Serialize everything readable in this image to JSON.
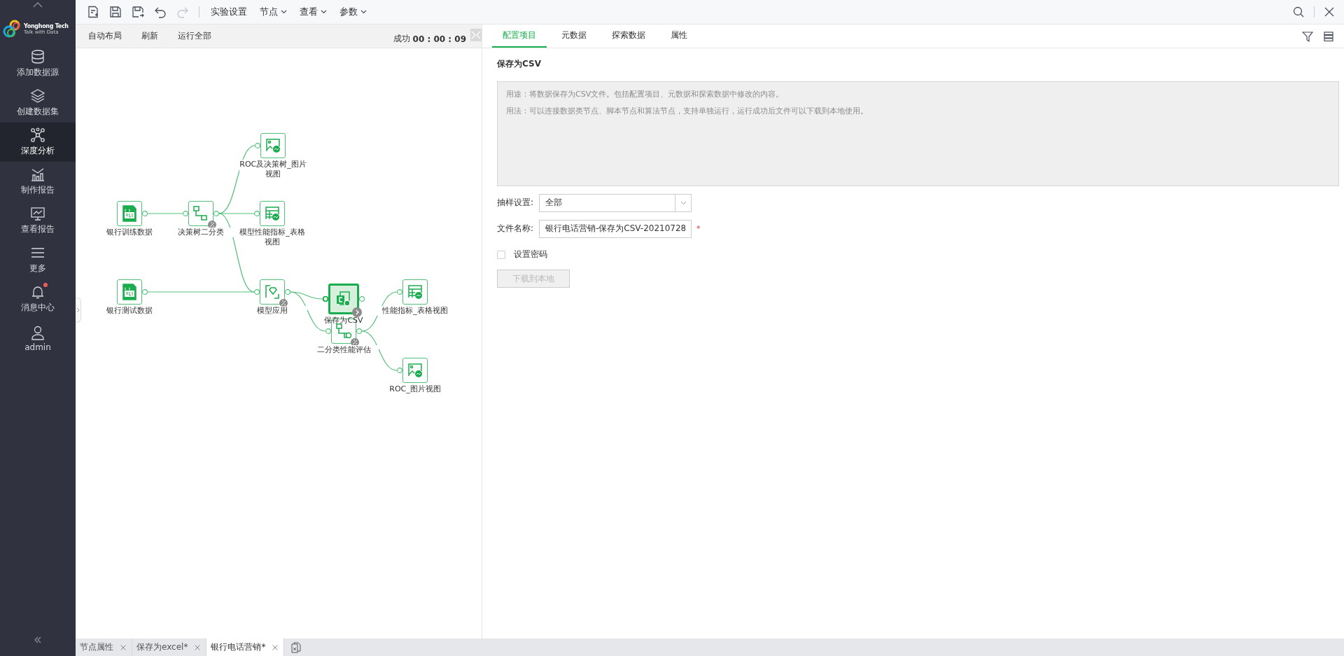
{
  "sidebar": {
    "logo": {
      "name": "Yonghong Tech",
      "slogan": "Talk with Data"
    },
    "items": [
      {
        "kind": "database",
        "label": "添加数据源",
        "selected": false,
        "notification": false
      },
      {
        "kind": "layers",
        "label": "创建数据集",
        "selected": false,
        "notification": false
      },
      {
        "kind": "network",
        "label": "深度分析",
        "selected": true,
        "notification": false
      },
      {
        "kind": "chart",
        "label": "制作报告",
        "selected": false,
        "notification": false
      },
      {
        "kind": "monitor",
        "label": "查看报告",
        "selected": false,
        "notification": false
      },
      {
        "kind": "menu",
        "label": "更多",
        "selected": false,
        "notification": false
      },
      {
        "kind": "bell",
        "label": "消息中心",
        "selected": false,
        "notification": true
      },
      {
        "kind": "user",
        "label": "admin",
        "selected": false,
        "notification": false
      }
    ]
  },
  "toolbar": {
    "icons": [
      {
        "kind": "new",
        "disabled": false
      },
      {
        "kind": "save",
        "disabled": false
      },
      {
        "kind": "save_as",
        "disabled": false
      },
      {
        "kind": "undo",
        "disabled": false
      },
      {
        "kind": "redo",
        "disabled": true
      }
    ],
    "menus": [
      {
        "label": "实验设置",
        "dropdown": false
      },
      {
        "label": "节点",
        "dropdown": true
      },
      {
        "label": "查看",
        "dropdown": true
      },
      {
        "label": "参数",
        "dropdown": true
      }
    ]
  },
  "canvas": {
    "actions": [
      "自动布局",
      "刷新",
      "运行全部"
    ],
    "status": "成功",
    "elapsed": "00 : 00 : 09",
    "nodes": [
      {
        "label": "银行训练数据",
        "kind": "sql",
        "selected": false
      },
      {
        "label": "决策树二分类",
        "kind": "tree",
        "selected": false
      },
      {
        "label": "ROC及决策树_图片视图",
        "kind": "image",
        "selected": false
      },
      {
        "label": "模型性能指标_表格视图",
        "kind": "table",
        "selected": false
      },
      {
        "label": "银行测试数据",
        "kind": "sql",
        "selected": false
      },
      {
        "label": "模型应用",
        "kind": "apply",
        "selected": false
      },
      {
        "label": "保存为CSV",
        "kind": "csv",
        "selected": true
      },
      {
        "label": "二分类性能评估",
        "kind": "eval",
        "selected": false
      },
      {
        "label": "性能指标_表格视图",
        "kind": "table",
        "selected": false
      },
      {
        "label": "ROC_图片视图",
        "kind": "image",
        "selected": false
      }
    ]
  },
  "panel": {
    "tabs": [
      {
        "label": "配置项目",
        "selected": true
      },
      {
        "label": "元数据",
        "selected": false
      },
      {
        "label": "探索数据",
        "selected": false
      },
      {
        "label": "属性",
        "selected": false
      }
    ],
    "title": "保存为CSV",
    "description": [
      "用途：将数据保存为CSV文件。包括配置项目、元数据和探索数据中修改的内容。",
      "用法：可以连接数据类节点、脚本节点和算法节点，支持单独运行，运行成功后文件可以下载到本地使用。"
    ],
    "sampling": {
      "label": "抽样设置:",
      "value": "全部"
    },
    "filename": {
      "label": "文件名称:",
      "value": "银行电话营销-保存为CSV-20210728",
      "required_mark": "*"
    },
    "password": {
      "label": "设置密码",
      "checked": false
    },
    "download": {
      "label": "下载到本地",
      "disabled": true
    }
  },
  "bottom_tabs": [
    {
      "label": "节点属性",
      "selected": false
    },
    {
      "label": "保存为excel*",
      "selected": false
    },
    {
      "label": "银行电话营销*",
      "selected": true
    }
  ]
}
